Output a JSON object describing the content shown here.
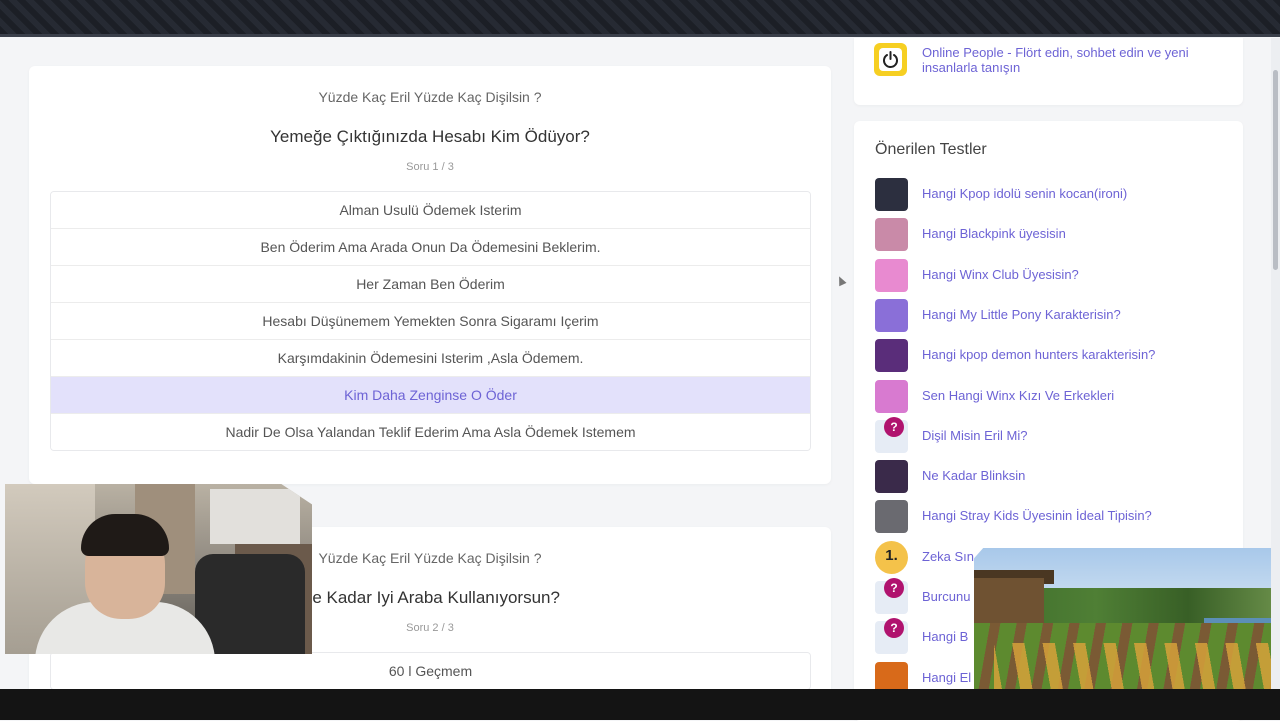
{
  "quizzes": [
    {
      "subtitle": "Yüzde Kaç Eril Yüzde Kaç Dişilsin ?",
      "question": "Yemeğe Çıktığınızda Hesabı Kim Ödüyor?",
      "counter": "Soru 1 / 3",
      "answers": [
        {
          "label": "Alman Usulü Ödemek Isterim",
          "selected": false
        },
        {
          "label": "Ben Öderim Ama Arada Onun Da Ödemesini Beklerim.",
          "selected": false
        },
        {
          "label": "Her Zaman Ben Öderim",
          "selected": false
        },
        {
          "label": "Hesabı Düşünemem Yemekten Sonra Sigaramı Içerim",
          "selected": false
        },
        {
          "label": "Karşımdakinin Ödemesini Isterim ,Asla Ödemem.",
          "selected": false
        },
        {
          "label": "Kim Daha Zenginse O Öder",
          "selected": true
        },
        {
          "label": "Nadir De Olsa Yalandan Teklif Ederim Ama Asla Ödemek Istemem",
          "selected": false
        }
      ]
    },
    {
      "subtitle": "Yüzde Kaç Eril Yüzde Kaç Dişilsin ?",
      "question": "Ne Kadar Iyi Araba Kullanıyorsun?",
      "counter": "Soru 2 / 3",
      "answers": [
        {
          "label": "60 l Geçmem",
          "selected": false
        }
      ]
    }
  ],
  "sidebar": {
    "online": {
      "icon": "power-icon",
      "text": "Online People - Flört edin, sohbet edin ve yeni insanlarla tanışın"
    },
    "tests_title": "Önerilen Testler",
    "tests": [
      {
        "label": "Hangi Kpop idolü senin kocan(ironi)",
        "thumb_color": "#2c2f3f"
      },
      {
        "label": "Hangi Blackpink üyesisin",
        "thumb_color": "#c98aa8"
      },
      {
        "label": "Hangi Winx Club Üyesisin?",
        "thumb_color": "#e88ad0"
      },
      {
        "label": "Hangi My Little Pony Karakterisin?",
        "thumb_color": "#8a6fd8"
      },
      {
        "label": "Hangi kpop demon hunters karakterisin?",
        "thumb_color": "#5a2d7a"
      },
      {
        "label": "Sen Hangi Winx Kızı Ve Erkekleri",
        "thumb_color": "#d87ad0"
      },
      {
        "label": "Dişil Misin Eril Mi?",
        "thumb_color": "#e6ecf5",
        "badge": "?"
      },
      {
        "label": "Ne Kadar Blinksin",
        "thumb_color": "#3a2a4a"
      },
      {
        "label": "Hangi Stray Kids Üyesinin İdeal Tipisin?",
        "thumb_color": "#6a6a70"
      },
      {
        "label": "Zeka Sın",
        "thumb_color": "#f4c24a",
        "badge_num": "1."
      },
      {
        "label": "Burcunu",
        "thumb_color": "#e6ecf5",
        "badge": "?"
      },
      {
        "label": "Hangi B",
        "thumb_color": "#e6ecf5",
        "badge": "?"
      },
      {
        "label": "Hangi El",
        "thumb_color": "#d86a1a"
      }
    ]
  },
  "colors": {
    "accent": "#6d63d5",
    "selected_bg": "#e3e1fb",
    "badge": "#b0136e"
  }
}
